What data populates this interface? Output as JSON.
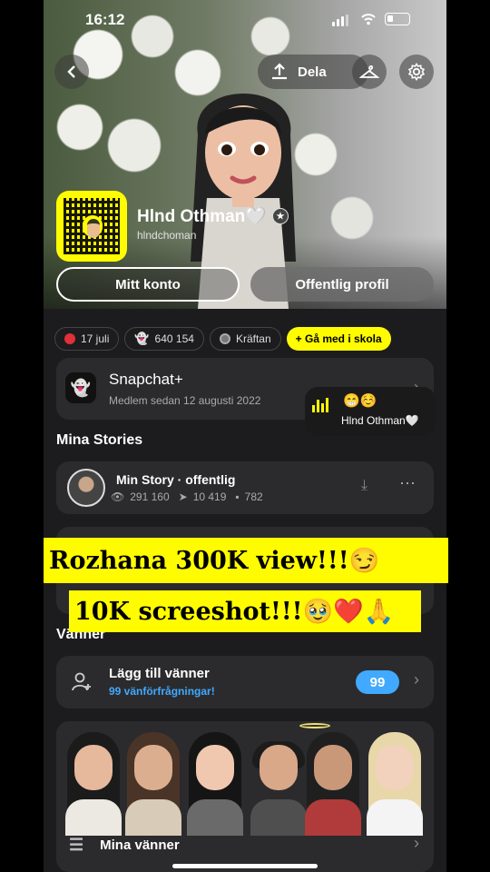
{
  "status": {
    "time": "16:12"
  },
  "header": {
    "share_label": "Dela"
  },
  "profile": {
    "name": "Hlnd Othman🤍",
    "username": "hlndchoman"
  },
  "buttons": {
    "account": "Mitt konto",
    "public_profile": "Offentlig profil"
  },
  "chips": [
    {
      "label": "17 juli",
      "icon": "balloon-icon"
    },
    {
      "label": "640 154",
      "icon": "ghost-icon"
    },
    {
      "label": "Kräftan",
      "icon": "zodiac-icon"
    },
    {
      "label": "+ Gå med i skola",
      "icon": ""
    }
  ],
  "snapchat_plus": {
    "title": "Snapchat+",
    "subtitle": "Medlem sedan 12 augusti 2022"
  },
  "bubble": {
    "emoji": "😁☺️",
    "name": "Hlnd Othman🤍"
  },
  "sections": {
    "stories": "Mina Stories",
    "friends": "Vänner"
  },
  "story": {
    "title": "Min Story · offentlig",
    "views": "291 160",
    "shares": "10 419",
    "screenshots": "782"
  },
  "banners": {
    "line1": "Rozhana 300K view!!!😏",
    "line2": "10K screeshot!!!🥹❤️🙏"
  },
  "friends_card": {
    "title": "Lägg till vänner",
    "subtitle": "99 vänförfrågningar!",
    "badge": "99"
  },
  "my_friends": {
    "label": "Mina vänner"
  },
  "colors": {
    "snap_yellow": "#fffc00",
    "badge_blue": "#41a9ff",
    "card": "#2b2b2d",
    "background": "#1c1c1e"
  }
}
